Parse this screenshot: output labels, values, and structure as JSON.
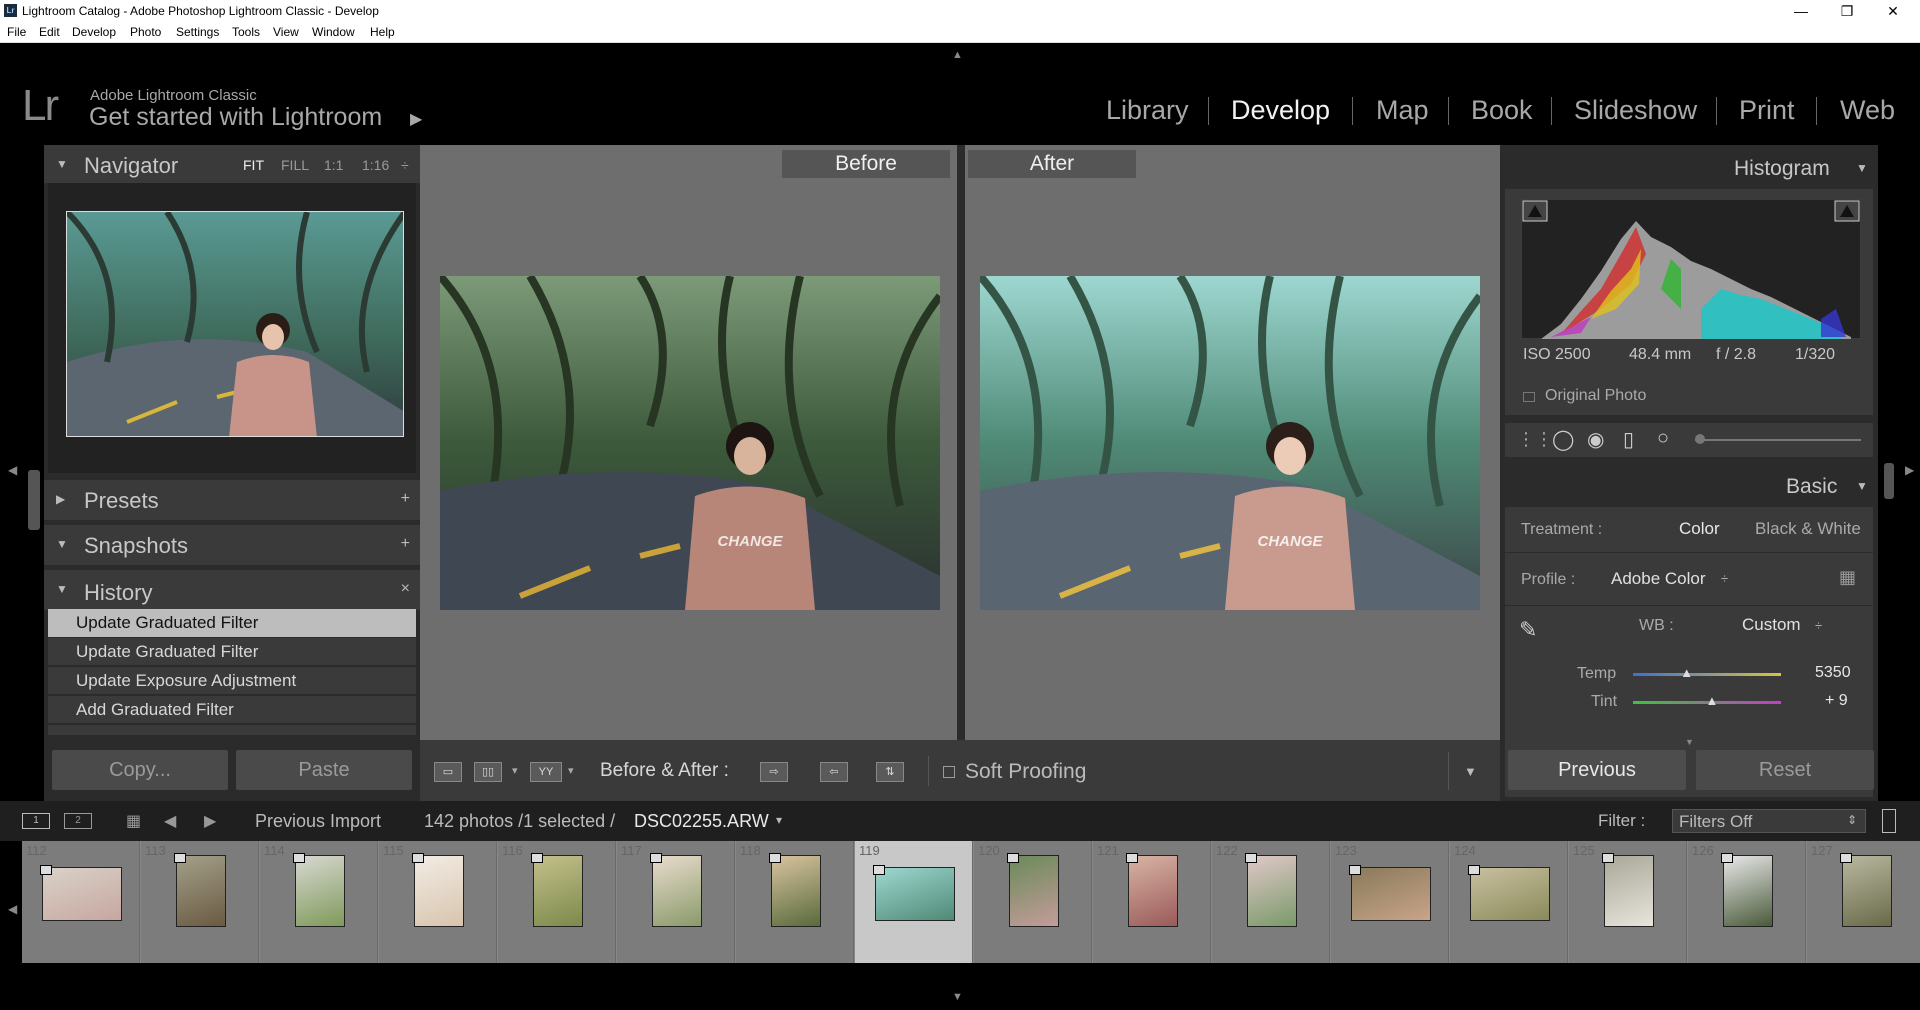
{
  "window": {
    "title": "Lightroom Catalog - Adobe Photoshop Lightroom Classic - Develop",
    "logo_text": "Lr",
    "controls": [
      "—",
      "❐",
      "✕"
    ]
  },
  "menu": [
    "File",
    "Edit",
    "Develop",
    "Photo",
    "Settings",
    "Tools",
    "View",
    "Window",
    "Help"
  ],
  "identity": {
    "logo": "Lr",
    "product": "Adobe Lightroom Classic",
    "tagline": "Get started with Lightroom",
    "arrow": "▶"
  },
  "modules": [
    "Library",
    "Develop",
    "Map",
    "Book",
    "Slideshow",
    "Print",
    "Web"
  ],
  "active_module": "Develop",
  "navigator": {
    "title": "Navigator",
    "zoom": [
      "FIT",
      "FILL",
      "1:1",
      "1:16"
    ],
    "zoom_more": "÷"
  },
  "presets": {
    "title": "Presets",
    "action": "+"
  },
  "snapshots": {
    "title": "Snapshots",
    "action": "+"
  },
  "history": {
    "title": "History",
    "action": "×",
    "items": [
      "Update Graduated Filter",
      "Update Graduated Filter",
      "Update Exposure Adjustment",
      "Add Graduated Filter"
    ],
    "selected_index": 0
  },
  "left_buttons": {
    "copy": "Copy...",
    "paste": "Paste"
  },
  "view": {
    "before": "Before",
    "after": "After"
  },
  "toolbar": {
    "ba_label": "Before & After :",
    "soft_proofing": "Soft Proofing",
    "yy": "YY",
    "dropdown": "▾"
  },
  "histogram": {
    "title": "Histogram",
    "iso": "ISO 2500",
    "focal": "48.4 mm",
    "aperture": "f / 2.8",
    "shutter": "1/320",
    "original": "Original Photo"
  },
  "basic": {
    "title": "Basic",
    "treatment_label": "Treatment :",
    "color": "Color",
    "bw": "Black & White",
    "profile_label": "Profile :",
    "profile_value": "Adobe Color",
    "wb_label": "WB :",
    "wb_value": "Custom",
    "temp_label": "Temp",
    "temp_value": "5350",
    "temp_pos": 0.36,
    "tint_label": "Tint",
    "tint_value": "+ 9",
    "tint_pos": 0.53
  },
  "right_buttons": {
    "previous": "Previous",
    "reset": "Reset"
  },
  "filmbar": {
    "source": "Previous Import",
    "count": "142 photos /1 selected /",
    "filename": "DSC02255.ARW",
    "filter_label": "Filter :",
    "filter_value": "Filters Off",
    "page1": "1",
    "page2": "2"
  },
  "film_cells": [
    {
      "num": "112",
      "orient": "land"
    },
    {
      "num": "113",
      "orient": "port"
    },
    {
      "num": "114",
      "orient": "port"
    },
    {
      "num": "115",
      "orient": "port"
    },
    {
      "num": "116",
      "orient": "port"
    },
    {
      "num": "117",
      "orient": "port"
    },
    {
      "num": "118",
      "orient": "port"
    },
    {
      "num": "119",
      "orient": "land"
    },
    {
      "num": "120",
      "orient": "port"
    },
    {
      "num": "121",
      "orient": "port"
    },
    {
      "num": "122",
      "orient": "port"
    },
    {
      "num": "123",
      "orient": "land"
    },
    {
      "num": "124",
      "orient": "land"
    },
    {
      "num": "125",
      "orient": "port"
    },
    {
      "num": "126",
      "orient": "port"
    },
    {
      "num": "127",
      "orient": "port"
    }
  ],
  "selected_cell": 7,
  "colors": {
    "accent_active": "#f2f2f2",
    "panel": "#2b2b2b",
    "header": "#3a3a3a"
  }
}
